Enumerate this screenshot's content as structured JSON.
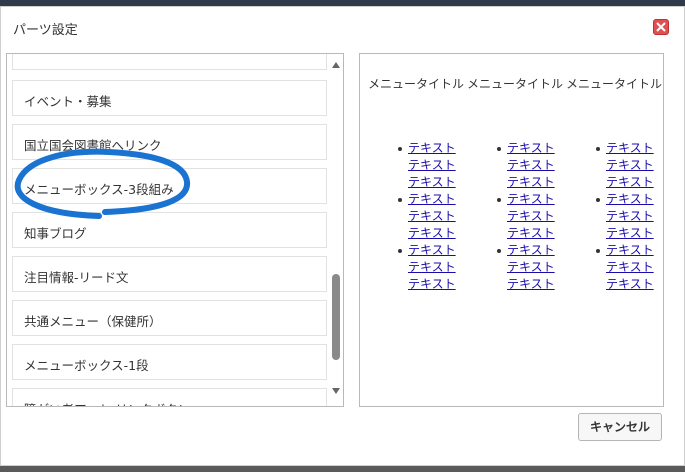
{
  "dialog": {
    "title": "パーツ設定",
    "cancel_label": "キャンセル"
  },
  "parts_list": [
    {
      "label": "イベント・募集"
    },
    {
      "label": "国立国会図書館へリンク"
    },
    {
      "label": "メニューボックス-3段組み"
    },
    {
      "label": "知事ブログ"
    },
    {
      "label": "注目情報-リード文"
    },
    {
      "label": "共通メニュー（保健所）"
    },
    {
      "label": "メニューボックス-1段"
    },
    {
      "label": "障がい者アート-リンクボタン"
    }
  ],
  "preview": {
    "columns": [
      {
        "title": "メニュータイトル",
        "items": [
          [
            "テキスト",
            "テキスト",
            "テキスト"
          ],
          [
            "テキスト",
            "テキスト",
            "テキスト"
          ],
          [
            "テキスト",
            "テキスト",
            "テキスト"
          ]
        ]
      },
      {
        "title": "メニュータイトル",
        "items": [
          [
            "テキスト",
            "テキスト",
            "テキスト"
          ],
          [
            "テキスト",
            "テキスト",
            "テキスト"
          ],
          [
            "テキスト",
            "テキスト",
            "テキスト"
          ]
        ]
      },
      {
        "title": "メニュータイトル",
        "items": [
          [
            "テキスト",
            "テキスト",
            "テキスト"
          ],
          [
            "テキスト",
            "テキスト",
            "テキスト"
          ],
          [
            "テキスト",
            "テキスト",
            "テキスト"
          ]
        ]
      }
    ]
  },
  "colors": {
    "link": "#1a0dab",
    "highlight_circle": "#1a73d0",
    "close_button": "#e05050"
  },
  "icons": {
    "close": "close-icon",
    "scroll_up": "arrow-up-icon",
    "scroll_down": "arrow-down-icon"
  }
}
